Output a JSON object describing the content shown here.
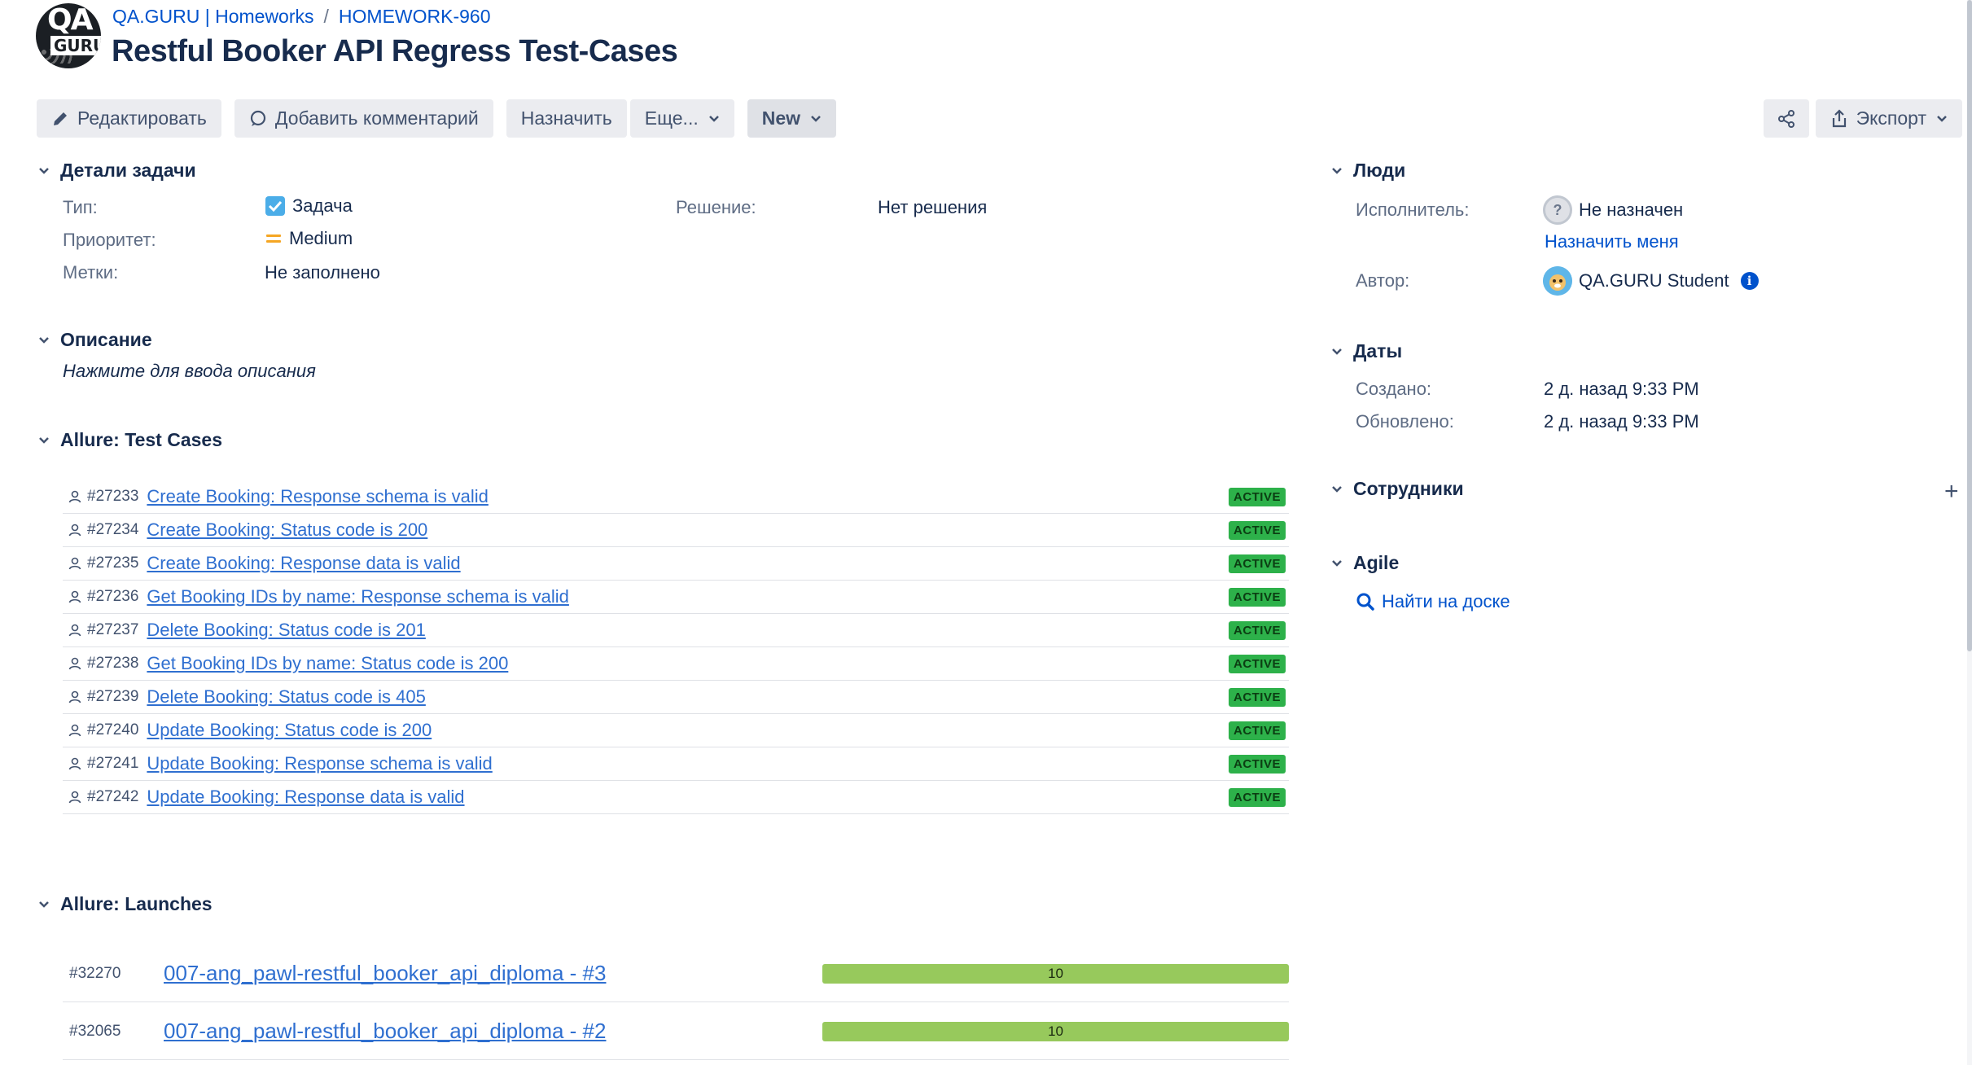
{
  "header": {
    "breadcrumb": [
      "QA.GURU | Homeworks",
      "HOMEWORK-960"
    ],
    "breadcrumb_sep": "/",
    "title": "Restful Booker API Regress Test-Cases",
    "logo_text_top": "QA",
    "logo_text_bottom": "GURU"
  },
  "toolbar": {
    "edit_label": "Редактировать",
    "comment_label": "Добавить комментарий",
    "assign_label": "Назначить",
    "more_label": "Еще...",
    "status_label": "New",
    "export_label": "Экспорт"
  },
  "details": {
    "heading": "Детали задачи",
    "type_label": "Тип:",
    "type_value": "Задача",
    "priority_label": "Приоритет:",
    "priority_value": "Medium",
    "labels_label": "Метки:",
    "labels_value": "Не заполнено",
    "resolution_label": "Решение:",
    "resolution_value": "Нет решения"
  },
  "description": {
    "heading": "Описание",
    "placeholder": "Нажмите для ввода описания"
  },
  "test_cases": {
    "heading": "Allure: Test Cases",
    "items": [
      {
        "id": "#27233",
        "name": "Create Booking: Response schema is valid",
        "status": "ACTIVE"
      },
      {
        "id": "#27234",
        "name": "Create Booking: Status code is 200",
        "status": "ACTIVE"
      },
      {
        "id": "#27235",
        "name": "Create Booking: Response data is valid",
        "status": "ACTIVE"
      },
      {
        "id": "#27236",
        "name": "Get Booking IDs by name: Response schema is valid",
        "status": "ACTIVE"
      },
      {
        "id": "#27237",
        "name": "Delete Booking: Status code is 201",
        "status": "ACTIVE"
      },
      {
        "id": "#27238",
        "name": "Get Booking IDs by name: Status code is 200",
        "status": "ACTIVE"
      },
      {
        "id": "#27239",
        "name": "Delete Booking: Status code is 405",
        "status": "ACTIVE"
      },
      {
        "id": "#27240",
        "name": "Update Booking: Status code is 200",
        "status": "ACTIVE"
      },
      {
        "id": "#27241",
        "name": "Update Booking: Response schema is valid",
        "status": "ACTIVE"
      },
      {
        "id": "#27242",
        "name": "Update Booking: Response data is valid",
        "status": "ACTIVE"
      }
    ]
  },
  "launches": {
    "heading": "Allure: Launches",
    "items": [
      {
        "id": "#32270",
        "name": "007-ang_pawl-restful_booker_api_diploma - #3",
        "count": "10"
      },
      {
        "id": "#32065",
        "name": "007-ang_pawl-restful_booker_api_diploma - #2",
        "count": "10"
      }
    ]
  },
  "people": {
    "heading": "Люди",
    "assignee_label": "Исполнитель:",
    "assignee_value": "Не назначен",
    "assign_me": "Назначить меня",
    "reporter_label": "Автор:",
    "reporter_value": "QA.GURU Student",
    "unknown_avatar": "?"
  },
  "dates": {
    "heading": "Даты",
    "created_label": "Создано:",
    "created_value": "2 д. назад 9:33 PM",
    "updated_label": "Обновлено:",
    "updated_value": "2 д. назад 9:33 PM"
  },
  "employees": {
    "heading": "Сотрудники",
    "add_symbol": "+"
  },
  "agile": {
    "heading": "Agile",
    "find_on_board": "Найти на доске"
  },
  "colors": {
    "link": "#0052cc",
    "active_badge": "#2db14a",
    "launch_bar": "#97c95c",
    "priority": "#f5a623"
  }
}
